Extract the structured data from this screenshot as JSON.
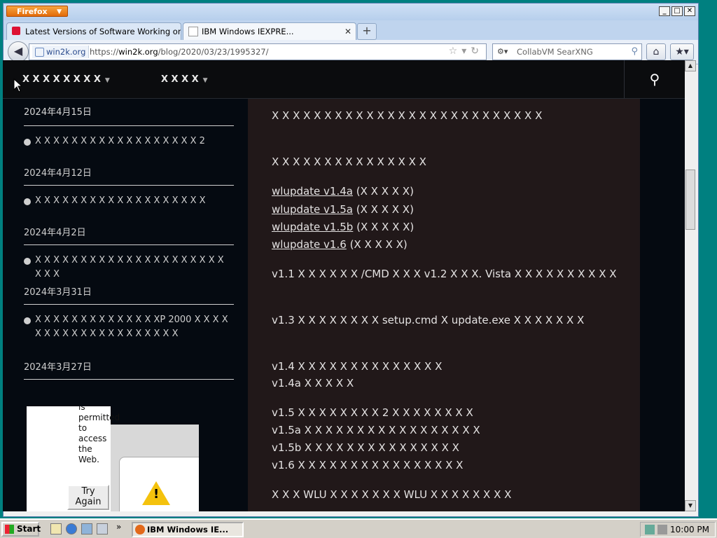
{
  "browser": {
    "menu_label": "Firefox",
    "window_buttons": [
      "_",
      "□",
      "✕"
    ],
    "tabs": [
      {
        "label": "Latest Versions of Software Working on W..."
      },
      {
        "label": "IBM Windows  IEXPRE..."
      }
    ],
    "site_identity": "win2k.org",
    "url_prefix": "https://",
    "url_host": "win2k.org",
    "url_path": "/blog/2020/03/23/1995327/",
    "search_placeholder": "CollabVM SearXNG"
  },
  "page": {
    "nav": {
      "menu1": "Ⅹ Ⅹ Ⅹ Ⅹ Ⅹ Ⅹ Ⅹ Ⅹ",
      "menu2": "Ⅹ Ⅹ Ⅹ Ⅹ"
    },
    "sidebar": {
      "first_date": "2024年4月15日",
      "items": [
        {
          "title": "Ⅹ Ⅹ Ⅹ Ⅹ Ⅹ Ⅹ Ⅹ Ⅹ Ⅹ Ⅹ Ⅹ Ⅹ Ⅹ Ⅹ Ⅹ Ⅹ Ⅹ Ⅹ 2",
          "date": "2024年4月12日"
        },
        {
          "title": "Ⅹ Ⅹ Ⅹ Ⅹ Ⅹ Ⅹ Ⅹ Ⅹ Ⅹ Ⅹ Ⅹ Ⅹ Ⅹ Ⅹ Ⅹ Ⅹ Ⅹ Ⅹ Ⅹ",
          "date": "2024年4月2日"
        },
        {
          "title": "Ⅹ Ⅹ Ⅹ Ⅹ Ⅹ Ⅹ Ⅹ Ⅹ Ⅹ Ⅹ Ⅹ Ⅹ Ⅹ Ⅹ Ⅹ Ⅹ Ⅹ Ⅹ Ⅹ Ⅹ Ⅹ Ⅹ Ⅹ Ⅹ",
          "date": "2024年3月31日"
        },
        {
          "title": "Ⅹ Ⅹ Ⅹ Ⅹ Ⅹ Ⅹ Ⅹ Ⅹ Ⅹ Ⅹ Ⅹ Ⅹ Ⅹ XP 2000 Ⅹ Ⅹ Ⅹ Ⅹ Ⅹ Ⅹ Ⅹ Ⅹ Ⅹ Ⅹ Ⅹ Ⅹ Ⅹ Ⅹ Ⅹ Ⅹ Ⅹ Ⅹ Ⅹ Ⅹ",
          "date": "2024年3月27日"
        }
      ]
    },
    "article": {
      "p1": "Ⅹ Ⅹ Ⅹ Ⅹ Ⅹ Ⅹ Ⅹ Ⅹ Ⅹ Ⅹ Ⅹ Ⅹ Ⅹ Ⅹ Ⅹ Ⅹ Ⅹ Ⅹ Ⅹ Ⅹ Ⅹ Ⅹ Ⅹ Ⅹ Ⅹ Ⅹ",
      "p2": "Ⅹ Ⅹ Ⅹ Ⅹ Ⅹ Ⅹ Ⅹ Ⅹ Ⅹ Ⅹ Ⅹ Ⅹ Ⅹ Ⅹ Ⅹ",
      "links": [
        {
          "text": "wlupdate v1.4a",
          "note": "(Ⅹ Ⅹ Ⅹ Ⅹ Ⅹ)"
        },
        {
          "text": "wlupdate v1.5a",
          "note": "(Ⅹ Ⅹ Ⅹ Ⅹ Ⅹ)"
        },
        {
          "text": "wlupdate v1.5b",
          "note": "(Ⅹ Ⅹ Ⅹ Ⅹ Ⅹ)"
        },
        {
          "text": "wlupdate v1.6",
          "note": "(Ⅹ Ⅹ Ⅹ Ⅹ Ⅹ)"
        }
      ],
      "p_v11": "v1.1 Ⅹ Ⅹ Ⅹ Ⅹ Ⅹ Ⅹ /CMD Ⅹ Ⅹ Ⅹ v1.2 Ⅹ Ⅹ Ⅹ. Vista Ⅹ Ⅹ Ⅹ Ⅹ Ⅹ Ⅹ Ⅹ Ⅹ Ⅹ Ⅹ",
      "p_v13": "v1.3 Ⅹ Ⅹ Ⅹ Ⅹ Ⅹ Ⅹ Ⅹ Ⅹ setup.cmd Ⅹ update.exe Ⅹ Ⅹ Ⅹ Ⅹ Ⅹ Ⅹ Ⅹ",
      "p_v14": "v1.4 Ⅹ Ⅹ Ⅹ Ⅹ Ⅹ Ⅹ Ⅹ Ⅹ Ⅹ Ⅹ Ⅹ Ⅹ Ⅹ Ⅹ",
      "p_v14a": "v1.4a Ⅹ Ⅹ Ⅹ Ⅹ Ⅹ",
      "p_v15": "v1.5 Ⅹ Ⅹ Ⅹ Ⅹ Ⅹ Ⅹ Ⅹ Ⅹ 2 Ⅹ Ⅹ Ⅹ Ⅹ Ⅹ Ⅹ Ⅹ Ⅹ",
      "p_v15a": "v1.5a Ⅹ Ⅹ Ⅹ Ⅹ Ⅹ Ⅹ Ⅹ Ⅹ Ⅹ Ⅹ Ⅹ Ⅹ Ⅹ Ⅹ Ⅹ Ⅹ Ⅹ",
      "p_v15b": "v1.5b Ⅹ Ⅹ Ⅹ Ⅹ Ⅹ Ⅹ Ⅹ Ⅹ Ⅹ Ⅹ Ⅹ Ⅹ Ⅹ Ⅹ Ⅹ",
      "p_v16": "v1.6 Ⅹ Ⅹ Ⅹ Ⅹ Ⅹ Ⅹ Ⅹ Ⅹ Ⅹ Ⅹ Ⅹ Ⅹ Ⅹ Ⅹ Ⅹ Ⅹ",
      "p_last": "Ⅹ Ⅹ Ⅹ WLU Ⅹ Ⅹ Ⅹ Ⅹ Ⅹ Ⅹ Ⅹ WLU Ⅹ Ⅹ Ⅹ Ⅹ Ⅹ Ⅹ Ⅹ Ⅹ"
    },
    "overlay": {
      "message": "is permitted to access the Web.",
      "try_again": "Try Again"
    }
  },
  "taskbar": {
    "start_label": "Start",
    "task_label": "IBM Windows IE...",
    "clock": "10:00 PM"
  }
}
